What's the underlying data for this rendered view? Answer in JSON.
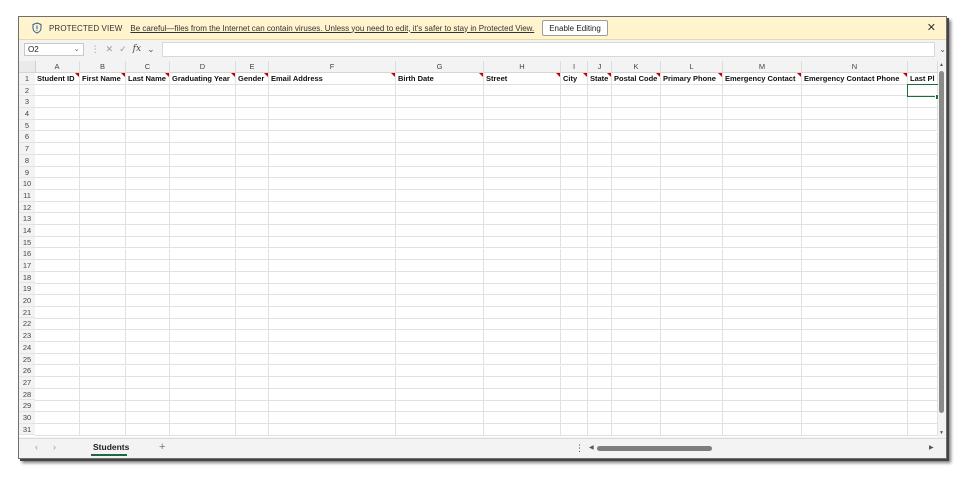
{
  "protected_view": {
    "title": "PROTECTED VIEW",
    "message": "Be careful—files from the Internet can contain viruses. Unless you need to edit, it's safer to stay in Protected View.",
    "enable_button": "Enable Editing",
    "close_glyph": "✕"
  },
  "formula_bar": {
    "name_box": "O2",
    "formula": "",
    "fx_label": "fx"
  },
  "columns": [
    {
      "letter": "A",
      "header": "Student ID",
      "comment": true
    },
    {
      "letter": "B",
      "header": "First Name",
      "comment": true
    },
    {
      "letter": "C",
      "header": "Last Name",
      "comment": true
    },
    {
      "letter": "D",
      "header": "Graduating Year",
      "comment": true
    },
    {
      "letter": "E",
      "header": "Gender",
      "comment": true
    },
    {
      "letter": "F",
      "header": "Email Address",
      "comment": true
    },
    {
      "letter": "G",
      "header": "Birth Date",
      "comment": true
    },
    {
      "letter": "H",
      "header": "Street",
      "comment": true
    },
    {
      "letter": "I",
      "header": "City",
      "comment": true
    },
    {
      "letter": "J",
      "header": "State",
      "comment": true
    },
    {
      "letter": "K",
      "header": "Postal Code",
      "comment": true
    },
    {
      "letter": "L",
      "header": "Primary Phone",
      "comment": true
    },
    {
      "letter": "M",
      "header": "Emergency Contact",
      "comment": true
    },
    {
      "letter": "N",
      "header": "Emergency Contact Phone",
      "comment": true
    },
    {
      "letter": "",
      "header": "Last Pl",
      "comment": false
    }
  ],
  "rows": [
    "1",
    "2",
    "3",
    "4",
    "5",
    "6",
    "7",
    "8",
    "9",
    "10",
    "11",
    "12",
    "13",
    "14",
    "15",
    "16",
    "17",
    "18",
    "19",
    "20",
    "21",
    "22",
    "23",
    "24",
    "25",
    "26",
    "27",
    "28",
    "29",
    "30",
    "31"
  ],
  "sheet": {
    "active_tab": "Students",
    "add_glyph": "+",
    "prev_glyph": "‹",
    "next_glyph": "›"
  },
  "colors": {
    "accent": "#1d6b3a",
    "protected_bar": "#fff4ce",
    "comment_marker": "#c00000"
  }
}
